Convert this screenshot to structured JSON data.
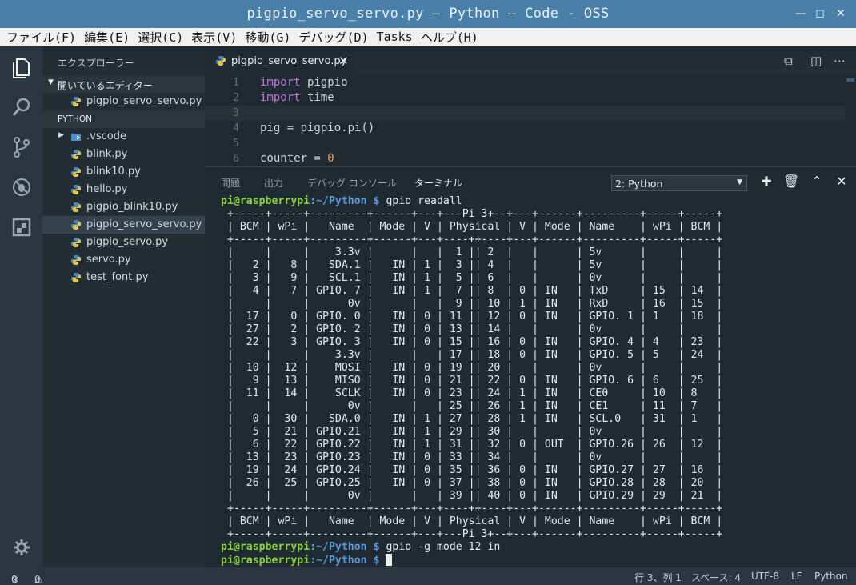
{
  "window": {
    "title": "pigpio_servo_servo.py — Python — Code - OSS"
  },
  "menu": [
    "ファイル(F)",
    "編集(E)",
    "選択(C)",
    "表示(V)",
    "移動(G)",
    "デバッグ(D)",
    "Tasks",
    "ヘルプ(H)"
  ],
  "sidebar": {
    "header": "エクスプローラー",
    "open_editors_label": "開いているエディター",
    "open_editors": [
      "pigpio_servo_servo.py"
    ],
    "folder_label": "PYTHON",
    "items": [
      ".vscode",
      "blink.py",
      "blink10.py",
      "hello.py",
      "pigpio_blink10.py",
      "pigpio_servo_servo.py",
      "pigpio_servo.py",
      "servo.py",
      "test_font.py"
    ]
  },
  "editor": {
    "tab_label": "pigpio_servo_servo.py",
    "lines": [
      {
        "no": "1",
        "kw": "import",
        "rest": " pigpio"
      },
      {
        "no": "2",
        "kw": "import",
        "rest": " time"
      },
      {
        "no": "3",
        "kw": "",
        "rest": ""
      },
      {
        "no": "4",
        "kw": "",
        "rest": "pig = pigpio.pi()"
      },
      {
        "no": "5",
        "kw": "",
        "rest": ""
      },
      {
        "no": "6",
        "kw": "",
        "rest": "counter = ",
        "num": "0"
      }
    ]
  },
  "panel": {
    "tabs": [
      "問題",
      "出力",
      "デバッグ コンソール",
      "ターミナル"
    ],
    "terminal_select": "2: Python"
  },
  "terminal": {
    "user": "pi@raspberrypi",
    "path": ":~/Python",
    "dollar": " $",
    "cmd1": " gpio readall",
    "table": [
      " +-----+-----+---------+------+---+---Pi 3+--+---+------+---------+-----+-----+",
      " | BCM | wPi |   Name  | Mode | V | Physical | V | Mode | Name    | wPi | BCM |",
      " +-----+-----+---------+------+---+----++----+---+------+---------+-----+-----+",
      " |     |     |    3.3v |      |   |  1 || 2  |   |      | 5v      |     |     |",
      " |   2 |   8 |   SDA.1 |   IN | 1 |  3 || 4  |   |      | 5v      |     |     |",
      " |   3 |   9 |   SCL.1 |   IN | 1 |  5 || 6  |   |      | 0v      |     |     |",
      " |   4 |   7 | GPIO. 7 |   IN | 1 |  7 || 8  | 0 | IN   | TxD     | 15  | 14  |",
      " |     |     |      0v |      |   |  9 || 10 | 1 | IN   | RxD     | 16  | 15  |",
      " |  17 |   0 | GPIO. 0 |   IN | 0 | 11 || 12 | 0 | IN   | GPIO. 1 | 1   | 18  |",
      " |  27 |   2 | GPIO. 2 |   IN | 0 | 13 || 14 |   |      | 0v      |     |     |",
      " |  22 |   3 | GPIO. 3 |   IN | 0 | 15 || 16 | 0 | IN   | GPIO. 4 | 4   | 23  |",
      " |     |     |    3.3v |      |   | 17 || 18 | 0 | IN   | GPIO. 5 | 5   | 24  |",
      " |  10 |  12 |    MOSI |   IN | 0 | 19 || 20 |   |      | 0v      |     |     |",
      " |   9 |  13 |    MISO |   IN | 0 | 21 || 22 | 0 | IN   | GPIO. 6 | 6   | 25  |",
      " |  11 |  14 |    SCLK |   IN | 0 | 23 || 24 | 1 | IN   | CE0     | 10  | 8   |",
      " |     |     |      0v |      |   | 25 || 26 | 1 | IN   | CE1     | 11  | 7   |",
      " |   0 |  30 |   SDA.0 |   IN | 1 | 27 || 28 | 1 | IN   | SCL.0   | 31  | 1   |",
      " |   5 |  21 | GPIO.21 |   IN | 1 | 29 || 30 |   |      | 0v      |     |     |",
      " |   6 |  22 | GPIO.22 |   IN | 1 | 31 || 32 | 0 | OUT  | GPIO.26 | 26  | 12  |",
      " |  13 |  23 | GPIO.23 |   IN | 0 | 33 || 34 |   |      | 0v      |     |     |",
      " |  19 |  24 | GPIO.24 |   IN | 0 | 35 || 36 | 0 | IN   | GPIO.27 | 27  | 16  |",
      " |  26 |  25 | GPIO.25 |   IN | 0 | 37 || 38 | 0 | IN   | GPIO.28 | 28  | 20  |",
      " |     |     |      0v |      |   | 39 || 40 | 0 | IN   | GPIO.29 | 29  | 21  |",
      " +-----+-----+---------+------+---+----++----+---+------+---------+-----+-----+",
      " | BCM | wPi |   Name  | Mode | V | Physical | V | Mode | Name    | wPi | BCM |",
      " +-----+-----+---------+------+---+---Pi 3+--+---+------+---------+-----+-----+"
    ],
    "cmd2": " gpio -g mode 12 in"
  },
  "status": {
    "errors": "0",
    "warnings": "0",
    "position": "行 3、列 1",
    "spaces": "スペース: 4",
    "encoding": "UTF-8",
    "eol": "LF",
    "language": "Python"
  },
  "colors": {
    "titlebar": "#4a7fa8",
    "prompt_user": "#8ad13a",
    "prompt_path": "#5a9bd8",
    "keyword": "#c478d8",
    "number": "#e9a35a"
  }
}
